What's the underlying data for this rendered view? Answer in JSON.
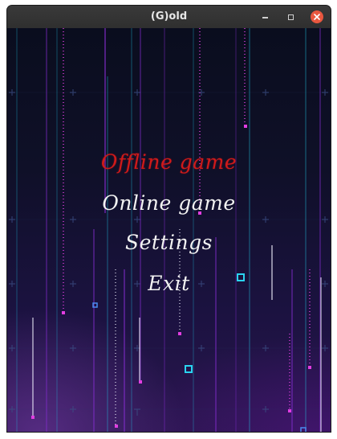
{
  "window": {
    "title": "(G)old"
  },
  "menu": {
    "offline": "Offline game",
    "online": "Online game",
    "settings": "Settings",
    "exit": "Exit"
  },
  "colors": {
    "selected": "#d01a1a",
    "normal": "#f2f2f2",
    "accent_cyan": "#2ad4f0",
    "accent_magenta": "#c238d6"
  }
}
